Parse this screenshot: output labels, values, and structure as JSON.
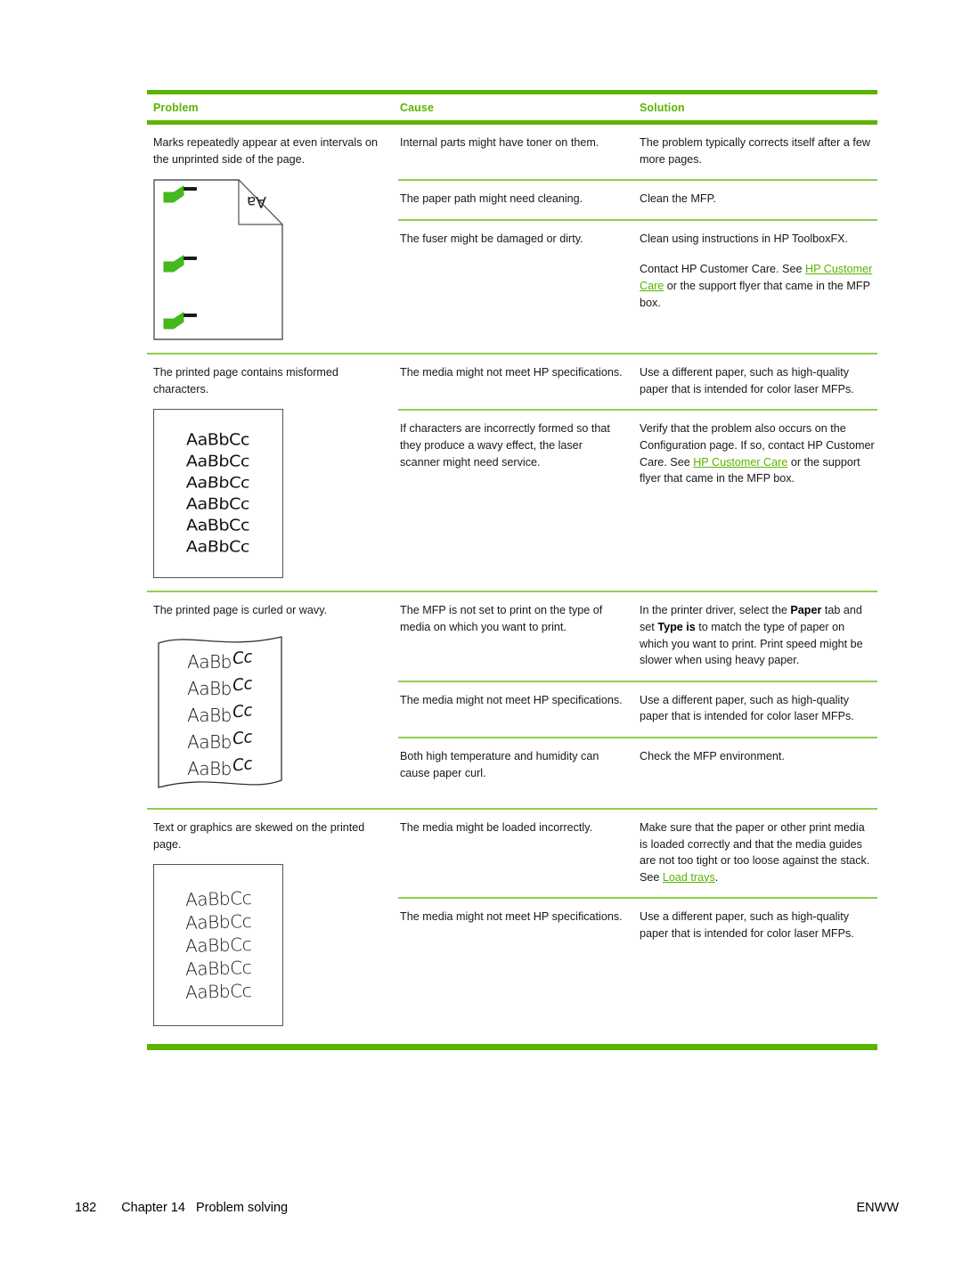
{
  "document": {
    "table_headers": {
      "problem": "Problem",
      "cause": "Cause",
      "solution": "Solution"
    },
    "accent_color": "#5bb400",
    "rule_color": "#8dcf4e",
    "link_color": "#5bb400"
  },
  "rows": [
    {
      "problem": "Marks repeatedly appear at even intervals on the unprinted side of the page.",
      "illustration": {
        "type": "page-with-folded-corner",
        "fold_text": "Aa",
        "marks": 3
      },
      "causes": [
        {
          "cause": "Internal parts might have toner on them.",
          "solution_parts": [
            {
              "type": "text",
              "value": "The problem typically corrects itself after a few more pages."
            }
          ]
        },
        {
          "cause": "The paper path might need cleaning.",
          "solution_parts": [
            {
              "type": "text",
              "value": "Clean the MFP."
            }
          ]
        },
        {
          "cause": "The fuser might be damaged or dirty.",
          "solution_parts": [
            {
              "type": "text",
              "value": "Clean using instructions in HP ToolboxFX."
            },
            {
              "type": "paragraph_break"
            },
            {
              "type": "text",
              "value": "Contact HP Customer Care. See "
            },
            {
              "type": "link",
              "value": "HP Customer Care"
            },
            {
              "type": "text",
              "value": " or the support flyer that came in the MFP box."
            }
          ]
        }
      ]
    },
    {
      "problem": "The printed page contains misformed characters.",
      "illustration": {
        "type": "misformed-characters",
        "sample_text": "AaBbCc",
        "lines": 6
      },
      "causes": [
        {
          "cause": "The media might not meet HP specifications.",
          "solution_parts": [
            {
              "type": "text",
              "value": "Use a different paper, such as high-quality paper that is intended for color laser MFPs."
            }
          ]
        },
        {
          "cause": "If characters are incorrectly formed so that they produce a wavy effect, the laser scanner might need service.",
          "solution_parts": [
            {
              "type": "text",
              "value": "Verify that the problem also occurs on the Configuration page. If so, contact HP Customer Care. See "
            },
            {
              "type": "link",
              "value": "HP Customer Care"
            },
            {
              "type": "text",
              "value": " or the support flyer that came in the MFP box."
            }
          ]
        }
      ]
    },
    {
      "problem": "The printed page is curled or wavy.",
      "illustration": {
        "type": "wavy-page",
        "sample_text": "AaBbCc",
        "lines": 5
      },
      "causes": [
        {
          "cause": "The MFP is not set to print on the type of media on which you want to print.",
          "solution_parts": [
            {
              "type": "text",
              "value": "In the printer driver, select the "
            },
            {
              "type": "bold",
              "value": "Paper"
            },
            {
              "type": "text",
              "value": " tab and set "
            },
            {
              "type": "bold",
              "value": "Type is"
            },
            {
              "type": "text",
              "value": " to match the type of paper on which you want to print. Print speed might be slower when using heavy paper."
            }
          ]
        },
        {
          "cause": "The media might not meet HP specifications.",
          "solution_parts": [
            {
              "type": "text",
              "value": "Use a different paper, such as high-quality paper that is intended for color laser MFPs."
            }
          ]
        },
        {
          "cause": "Both high temperature and humidity can cause paper curl.",
          "solution_parts": [
            {
              "type": "text",
              "value": "Check the MFP environment."
            }
          ]
        }
      ]
    },
    {
      "problem": "Text or graphics are skewed on the printed page.",
      "illustration": {
        "type": "skewed-characters",
        "sample_text": "AaBbCc",
        "lines": 5
      },
      "causes": [
        {
          "cause": "The media might be loaded incorrectly.",
          "solution_parts": [
            {
              "type": "text",
              "value": "Make sure that the paper or other print media is loaded correctly and that the media guides are not too tight or too loose against the stack. See "
            },
            {
              "type": "link",
              "value": "Load trays"
            },
            {
              "type": "text",
              "value": "."
            }
          ]
        },
        {
          "cause": "The media might not meet HP specifications.",
          "solution_parts": [
            {
              "type": "text",
              "value": "Use a different paper, such as high-quality paper that is intended for color laser MFPs."
            }
          ]
        }
      ]
    }
  ],
  "footer": {
    "page_number": "182",
    "chapter": "Chapter 14",
    "chapter_title": "Problem solving",
    "right_label": "ENWW"
  }
}
